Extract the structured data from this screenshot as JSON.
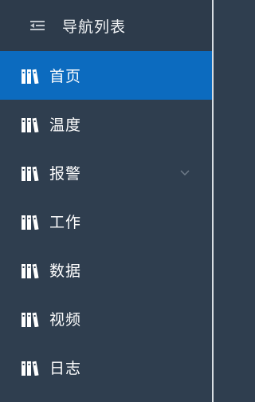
{
  "colors": {
    "sidebar_bg": "#2f3e4f",
    "active_bg": "#0c6bbf",
    "text": "#ffffff",
    "border": "#d8dde2"
  },
  "header": {
    "title": "导航列表",
    "icon": "menu-collapse-icon"
  },
  "menu": {
    "items": [
      {
        "label": "首页",
        "icon": "books-icon",
        "active": true
      },
      {
        "label": "温度",
        "icon": "books-icon",
        "active": false
      },
      {
        "label": "报警",
        "icon": "books-icon",
        "active": false,
        "has_submenu": true
      },
      {
        "label": "工作",
        "icon": "books-icon",
        "active": false
      },
      {
        "label": "数据",
        "icon": "books-icon",
        "active": false
      },
      {
        "label": "视频",
        "icon": "books-icon",
        "active": false
      },
      {
        "label": "日志",
        "icon": "books-icon",
        "active": false
      }
    ]
  }
}
